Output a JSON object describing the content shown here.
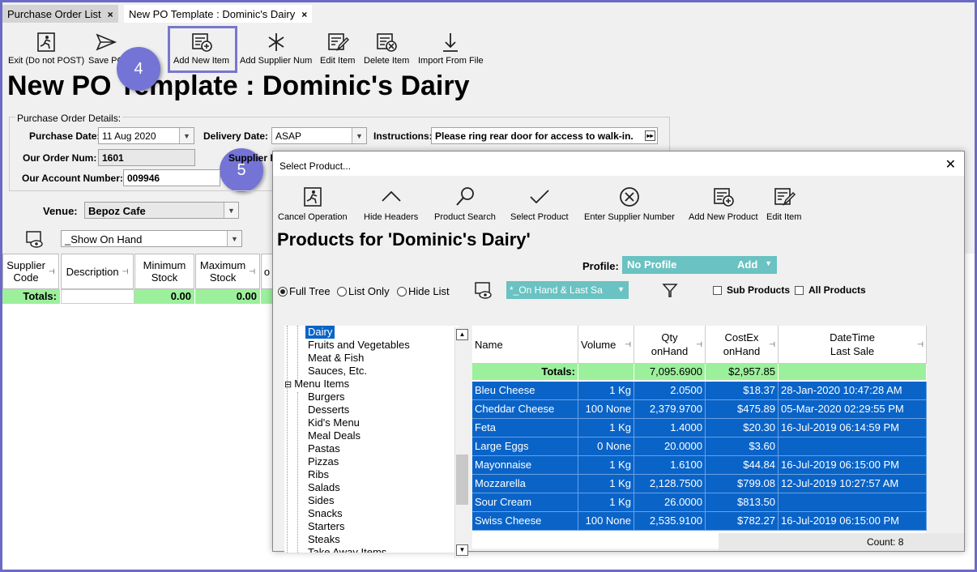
{
  "tabs": [
    {
      "label": "Purchase Order List"
    },
    {
      "label": "New PO Template : Dominic's Dairy"
    }
  ],
  "tab_close": "×",
  "toolbar": [
    {
      "label": "Exit (Do not POST)"
    },
    {
      "label": "Save PO"
    },
    {
      "label": "Add New Item"
    },
    {
      "label": "Add Supplier Num"
    },
    {
      "label": "Edit Item"
    },
    {
      "label": "Delete Item"
    },
    {
      "label": "Import From File"
    }
  ],
  "page_title": "New PO Template : Dominic's Dairy",
  "details": {
    "group_label": "Purchase Order Details:",
    "purchase_date_label": "Purchase Date:",
    "purchase_date": "11 Aug 2020",
    "delivery_date_label": "Delivery Date:",
    "delivery_date": "ASAP",
    "instructions_label": "Instructions:",
    "instructions": "Please ring rear door for access to walk-in.",
    "order_num_label": "Our Order Num:",
    "order_num": "1601",
    "supplier_label_partial": "Supplier R",
    "account_label": "Our Account Number:",
    "account": "009946"
  },
  "venue": {
    "label": "Venue:",
    "value": "Bepoz Cafe"
  },
  "show_filter": "_Show On Hand",
  "main_grid": {
    "headers": [
      "Supplier\nCode",
      "Description",
      "Minimum\nStock",
      "Maximum\nStock",
      "o"
    ],
    "totals_label": "Totals:",
    "min_total": "0.00",
    "max_total": "0.00"
  },
  "callouts": [
    "4",
    "5"
  ],
  "dialog": {
    "title": "Select Product...",
    "close": "✕",
    "toolbar": [
      {
        "label": "Cancel Operation"
      },
      {
        "label": "Hide Headers"
      },
      {
        "label": "Product Search"
      },
      {
        "label": "Select Product"
      },
      {
        "label": "Enter Supplier Number"
      },
      {
        "label": "Add New Product"
      },
      {
        "label": "Edit Item"
      }
    ],
    "heading": "Products for 'Dominic's Dairy'",
    "profile_label": "Profile:",
    "profile_value": "No Profile",
    "profile_add": "Add",
    "radios": [
      {
        "label": "Full Tree",
        "checked": true
      },
      {
        "label": "List Only",
        "checked": false
      },
      {
        "label": "Hide List",
        "checked": false
      }
    ],
    "filter_value": "*_On Hand & Last Sa",
    "sub_products": "Sub Products",
    "all_products": "All Products",
    "tree": {
      "selected": "Dairy",
      "children1": [
        "Fruits and Vegetables",
        "Meat & Fish",
        "Sauces, Etc."
      ],
      "group": "Menu Items",
      "group_toggle": "⊟",
      "children2": [
        "Burgers",
        "Desserts",
        "Kid's Menu",
        "Meal Deals",
        "Pastas",
        "Pizzas",
        "Ribs",
        "Salads",
        "Sides",
        "Snacks",
        "Starters",
        "Steaks",
        "Take Away Items"
      ]
    },
    "grid": {
      "headers": [
        "Name",
        "Volume",
        "Qty\nonHand",
        "CostEx\nonHand",
        "DateTime\nLast Sale"
      ],
      "totals_label": "Totals:",
      "qty_total": "7,095.6900",
      "cost_total": "$2,957.85",
      "rows": [
        {
          "name": "Bleu Cheese",
          "volume": "1 Kg",
          "qty": "2.0500",
          "cost": "$18.37",
          "date": "28-Jan-2020 10:47:28 AM"
        },
        {
          "name": "Cheddar Cheese",
          "volume": "100 None",
          "qty": "2,379.9700",
          "cost": "$475.89",
          "date": "05-Mar-2020 02:29:55 PM"
        },
        {
          "name": "Feta",
          "volume": "1 Kg",
          "qty": "1.4000",
          "cost": "$20.30",
          "date": "16-Jul-2019 06:14:59 PM"
        },
        {
          "name": "Large Eggs",
          "volume": "0 None",
          "qty": "20.0000",
          "cost": "$3.60",
          "date": ""
        },
        {
          "name": "Mayonnaise",
          "volume": "1 Kg",
          "qty": "1.6100",
          "cost": "$44.84",
          "date": "16-Jul-2019 06:15:00 PM"
        },
        {
          "name": "Mozzarella",
          "volume": "1 Kg",
          "qty": "2,128.7500",
          "cost": "$799.08",
          "date": "12-Jul-2019 10:27:57 AM"
        },
        {
          "name": "Sour Cream",
          "volume": "1 Kg",
          "qty": "26.0000",
          "cost": "$813.50",
          "date": ""
        },
        {
          "name": "Swiss Cheese",
          "volume": "100 None",
          "qty": "2,535.9100",
          "cost": "$782.27",
          "date": "16-Jul-2019 06:15:00 PM"
        }
      ]
    },
    "count": "Count: 8"
  }
}
